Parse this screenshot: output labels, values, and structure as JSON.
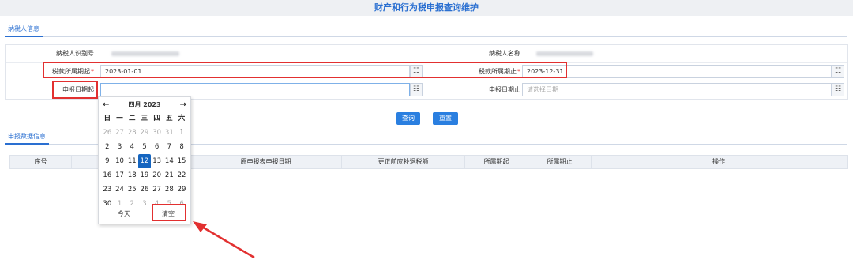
{
  "page_title": "财产和行为税申报查询维护",
  "tabs": {
    "taxpayer": "纳税人信息",
    "declaration": "申报数据信息"
  },
  "form": {
    "taxpayer_id_label": "纳税人识别号",
    "taxpayer_name_label": "纳税人名称",
    "period_start_label": "税款所属期起",
    "period_start_value": "2023-01-01",
    "period_end_label": "税款所属期止",
    "period_end_value": "2023-12-31",
    "decl_start_label": "申报日期起",
    "decl_start_value": "",
    "decl_end_label": "申报日期止",
    "decl_end_placeholder": "请选择日期",
    "required_mark": "*"
  },
  "buttons": {
    "query": "查询",
    "reset": "重置"
  },
  "table": {
    "headers": [
      "序号",
      "",
      "原申报表申报日期",
      "更正前应补退税额",
      "所属期起",
      "所属期止",
      "操作"
    ]
  },
  "calendar": {
    "prev": "←",
    "next": "→",
    "month_title": "四月 2023",
    "weekdays": [
      "日",
      "一",
      "二",
      "三",
      "四",
      "五",
      "六"
    ],
    "weeks": [
      [
        {
          "d": "26",
          "dim": true
        },
        {
          "d": "27",
          "dim": true
        },
        {
          "d": "28",
          "dim": true
        },
        {
          "d": "29",
          "dim": true
        },
        {
          "d": "30",
          "dim": true
        },
        {
          "d": "31",
          "dim": true
        },
        {
          "d": "1",
          "dim": false
        }
      ],
      [
        {
          "d": "2",
          "dim": false
        },
        {
          "d": "3",
          "dim": false
        },
        {
          "d": "4",
          "dim": false
        },
        {
          "d": "5",
          "dim": false
        },
        {
          "d": "6",
          "dim": false
        },
        {
          "d": "7",
          "dim": false
        },
        {
          "d": "8",
          "dim": false
        }
      ],
      [
        {
          "d": "9",
          "dim": false
        },
        {
          "d": "10",
          "dim": false
        },
        {
          "d": "11",
          "dim": false
        },
        {
          "d": "12",
          "dim": false,
          "today": true
        },
        {
          "d": "13",
          "dim": false
        },
        {
          "d": "14",
          "dim": false
        },
        {
          "d": "15",
          "dim": false
        }
      ],
      [
        {
          "d": "16",
          "dim": false
        },
        {
          "d": "17",
          "dim": false
        },
        {
          "d": "18",
          "dim": false
        },
        {
          "d": "19",
          "dim": false
        },
        {
          "d": "20",
          "dim": false
        },
        {
          "d": "21",
          "dim": false
        },
        {
          "d": "22",
          "dim": false
        }
      ],
      [
        {
          "d": "23",
          "dim": false
        },
        {
          "d": "24",
          "dim": false
        },
        {
          "d": "25",
          "dim": false
        },
        {
          "d": "26",
          "dim": false
        },
        {
          "d": "27",
          "dim": false
        },
        {
          "d": "28",
          "dim": false
        },
        {
          "d": "29",
          "dim": false
        }
      ],
      [
        {
          "d": "30",
          "dim": false
        },
        {
          "d": "1",
          "dim": true
        },
        {
          "d": "2",
          "dim": true
        },
        {
          "d": "3",
          "dim": true
        },
        {
          "d": "4",
          "dim": true
        },
        {
          "d": "5",
          "dim": true
        },
        {
          "d": "6",
          "dim": true
        }
      ]
    ],
    "today_label": "今天",
    "clear_label": "清空"
  },
  "colors": {
    "accent": "#2a7fe0",
    "highlight": "#e23030",
    "title": "#2a6fd1"
  }
}
